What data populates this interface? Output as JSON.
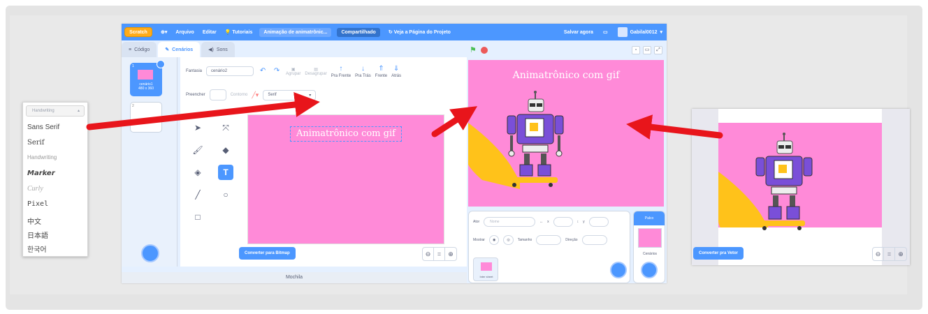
{
  "menubar": {
    "logo": "Scratch",
    "lang_icon": "globe-icon",
    "file": "Arquivo",
    "edit": "Editar",
    "tutorials": "Tutoriais",
    "project_title": "Animação de animatrônic...",
    "share": "Compartilhado",
    "see_project": "Veja a Página do Projeto",
    "save_now": "Salvar agora",
    "user": "Gabilal0012"
  },
  "tabs": [
    "Código",
    "Cenários",
    "Sons"
  ],
  "costume_list": {
    "item1_index": "1",
    "item1_name": "cenário1",
    "item1_size": "480 x 360",
    "item2_index": "2"
  },
  "paint_toolbar": {
    "costume_label": "Fantasia",
    "costume_name": "cenário2",
    "group": "Agrupar",
    "ungroup": "Desagrupar",
    "forward": "Pra Frente",
    "backward": "Pra Trás",
    "front": "Frente",
    "back": "Atrás",
    "fill_label": "Preencher",
    "outline_label": "Contorno",
    "font_value": "Serif"
  },
  "canvas": {
    "text": "Animatrônico com gif",
    "convert_button": "Converter para Bitmap"
  },
  "mochila": "Mochila",
  "stage": {
    "title": "Animatrônico com gif"
  },
  "sprite_info": {
    "actor_label": "Ator",
    "actor_value": "Nome",
    "x_label": "x",
    "y_label": "y",
    "show_label": "Mostrar",
    "size_label": "Tamanho",
    "direction_label": "Direção",
    "sprite_thumb_label": "Inter sheet"
  },
  "stage_panel": {
    "header": "Palco",
    "backdrops_label": "Cenários"
  },
  "font_dropdown": {
    "current": "Handwriting",
    "options": [
      "Sans Serif",
      "Serif",
      "Handwriting",
      "Marker",
      "Curly",
      "Pixel",
      "中文",
      "日本語",
      "한국어"
    ]
  },
  "right_view": {
    "convert_button": "Converter pra Vetor"
  },
  "colors": {
    "scratch_blue": "#4c97ff",
    "stage_pink": "#ff8ad8",
    "arrow_red": "#e8151b"
  }
}
